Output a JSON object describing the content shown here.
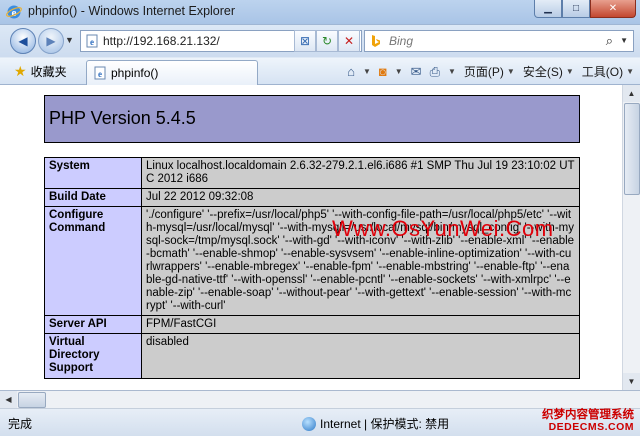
{
  "window": {
    "title": "phpinfo() - Windows Internet Explorer",
    "min_glyph": "▁",
    "max_glyph": "□",
    "close_glyph": "✕"
  },
  "nav": {
    "url": "http://192.168.21.132/",
    "search_placeholder": "Bing"
  },
  "commandbar": {
    "favorites_label": "收藏夹",
    "tab_title": "phpinfo()",
    "page_menu": "页面(P)",
    "safety_menu": "安全(S)",
    "tools_menu": "工具(O)"
  },
  "php": {
    "version_heading": "PHP Version 5.4.5",
    "rows": [
      {
        "key": "System",
        "value": "Linux localhost.localdomain 2.6.32-279.2.1.el6.i686 #1 SMP Thu Jul 19 23:10:02 UTC 2012 i686"
      },
      {
        "key": "Build Date",
        "value": "Jul 22 2012 09:32:08"
      },
      {
        "key": "Configure Command",
        "value": "'./configure' '--prefix=/usr/local/php5' '--with-config-file-path=/usr/local/php5/etc' '--with-mysql=/usr/local/mysql' '--with-mysqli=/usr/local/mysql/bin/mysql_config' '--with-mysql-sock=/tmp/mysql.sock' '--with-gd' '--with-iconv' '--with-zlib' '--enable-xml' '--enable-bcmath' '--enable-shmop' '--enable-sysvsem' '--enable-inline-optimization' '--with-curlwrappers' '--enable-mbregex' '--enable-fpm' '--enable-mbstring' '--enable-ftp' '--enable-gd-native-ttf' '--with-openssl' '--enable-pcntl' '--enable-sockets' '--with-xmlrpc' '--enable-zip' '--enable-soap' '--without-pear' '--with-gettext' '--enable-session' '--with-mcrypt' '--with-curl'"
      },
      {
        "key": "Server API",
        "value": "FPM/FastCGI"
      },
      {
        "key": "Virtual Directory Support",
        "value": "disabled"
      }
    ]
  },
  "watermark": "Www.OsYunWei.Com",
  "status": {
    "done": "完成",
    "zone": "Internet | 保护模式: 禁用",
    "corner_line1": "织梦内容管理系统",
    "corner_line2": "DEDECMS.COM"
  },
  "colors": {
    "php_header": "#9999cc",
    "php_key": "#ccccff",
    "php_value": "#cccccc",
    "watermark": "#e0000a"
  }
}
